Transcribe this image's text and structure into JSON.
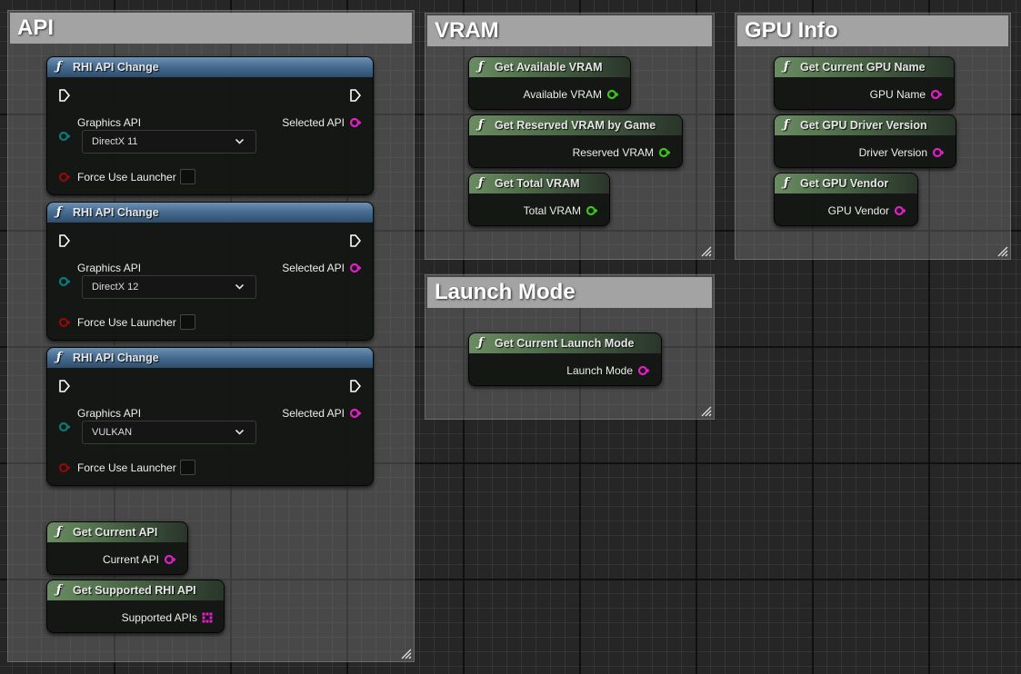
{
  "groups": {
    "api": {
      "title": "API"
    },
    "vram": {
      "title": "VRAM"
    },
    "gpu_info": {
      "title": "GPU Info"
    },
    "launch_mode": {
      "title": "Launch Mode"
    }
  },
  "rhi_nodes": [
    {
      "title": "RHI API Change",
      "graphics_api_label": "Graphics API",
      "selected_value": "DirectX 11",
      "output_label": "Selected API",
      "force_label": "Force Use Launcher"
    },
    {
      "title": "RHI API Change",
      "graphics_api_label": "Graphics API",
      "selected_value": "DirectX 12",
      "output_label": "Selected API",
      "force_label": "Force Use Launcher"
    },
    {
      "title": "RHI API Change",
      "graphics_api_label": "Graphics API",
      "selected_value": "VULKAN",
      "output_label": "Selected API",
      "force_label": "Force Use Launcher"
    }
  ],
  "function_icon": "ƒ",
  "nodes": {
    "get_current_api": {
      "title": "Get Current API",
      "output": "Current API"
    },
    "get_supported_rhi_api": {
      "title": "Get Supported RHI API",
      "output": "Supported APIs"
    },
    "get_available_vram": {
      "title": "Get Available VRAM",
      "output": "Available VRAM"
    },
    "get_reserved_vram": {
      "title": "Get Reserved VRAM by Game",
      "output": "Reserved VRAM"
    },
    "get_total_vram": {
      "title": "Get Total VRAM",
      "output": "Total VRAM"
    },
    "get_gpu_name": {
      "title": "Get Current GPU Name",
      "output": "GPU Name"
    },
    "get_gpu_driver": {
      "title": "Get GPU Driver Version",
      "output": "Driver Version"
    },
    "get_gpu_vendor": {
      "title": "Get GPU Vendor",
      "output": "GPU Vendor"
    },
    "get_launch_mode": {
      "title": "Get Current Launch Mode",
      "output": "Launch Mode"
    }
  },
  "pin_colors": {
    "string": "#e21ec7",
    "integer": "#3ec51c",
    "enum": "#0b7b75",
    "boolean": "#8f0b0b",
    "exec": "#ffffff",
    "array": "#e21ec7"
  },
  "icons": [
    "function-icon",
    "exec-pin-icon",
    "chevron-down-icon",
    "resize-grip-icon",
    "array-pin-icon"
  ]
}
